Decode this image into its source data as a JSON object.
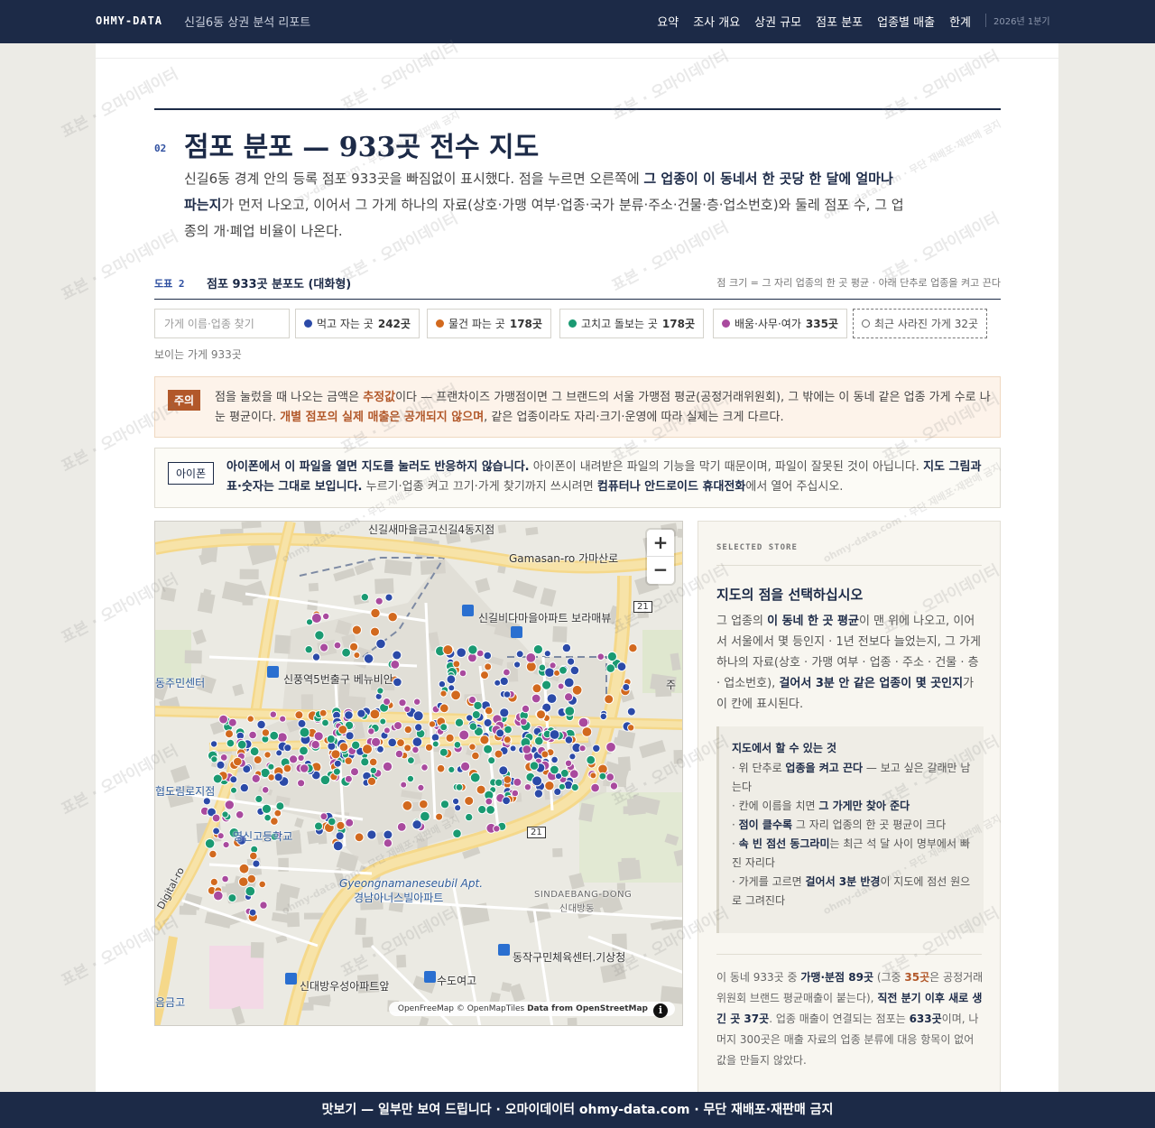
{
  "header": {
    "brand": "OHMY-DATA",
    "subtitle": "신길6동 상권 분석 리포트",
    "nav": [
      "요약",
      "조사 개요",
      "상권 규모",
      "점포 분포",
      "업종별 매출",
      "한계"
    ],
    "period": "2026년 1분기"
  },
  "section": {
    "number": "02",
    "title": "점포 분포 — 933곳 전수 지도",
    "lead_1": "신길6동 경계 안의 등록 점포 933곳을 빠짐없이 표시했다. 점을 누르면 오른쪽에 ",
    "lead_bold_1": "그 업종이 이 동네서 한 곳당 한 달에 얼마나 파는지",
    "lead_2": "가 먼저 나오고, 이어서 그 가게 하나의 자료(상호·가맹 여부·업종·국가 분류·주소·건물·층·업소번호)와 둘레 점포 수, 그 업종의 개·폐업 비율이 나온다."
  },
  "figure": {
    "label": "도표 2",
    "title": "점포 933곳 분포도 (대화형)",
    "note": "점 크기 = 그 자리 업종의 한 곳 평균 · 아래 단추로 업종을 켜고 끈다"
  },
  "controls": {
    "search_placeholder": "가게 이름·업종 찾기",
    "chips": [
      {
        "label": "먹고 자는 곳",
        "count": "242곳",
        "color": "#2b4aa8"
      },
      {
        "label": "물건 파는 곳",
        "count": "178곳",
        "color": "#d2691e"
      },
      {
        "label": "고치고 돌보는 곳",
        "count": "178곳",
        "color": "#1a9a72"
      },
      {
        "label": "배움·사무·여가",
        "count": "335곳",
        "color": "#a94a9e"
      }
    ],
    "closed_chip": "최근 사라진 가게 32곳",
    "visible_count": "보이는 가게 933곳"
  },
  "caution": {
    "tag": "주의",
    "t1": "점을 눌렀을 때 나오는 금액은 ",
    "h1": "추정값",
    "t2": "이다 — 프랜차이즈 가맹점이면 그 브랜드의 서울 가맹점 평균(공정거래위원회), 그 밖에는 이 동네 같은 업종 가게 수로 나눈 평균이다. ",
    "h2": "개별 점포의 실제 매출은 공개되지 않으며",
    "t3": ", 같은 업종이라도 자리·크기·운영에 따라 실제는 크게 다르다."
  },
  "iphone": {
    "tag": "아이폰",
    "b1": "아이폰에서 이 파일을 열면 지도를 눌러도 반응하지 않습니다.",
    "t1": " 아이폰이 내려받은 파일의 기능을 막기 때문이며, 파일이 잘못된 것이 아닙니다. ",
    "b2": "지도 그림과 표·숫자는 그대로 보입니다.",
    "t2": " 누르기·업종 켜고 끄기·가게 찾기까지 쓰시려면 ",
    "b3": "컴퓨터나 안드로이드 휴대전화",
    "t3": "에서 열어 주십시오."
  },
  "map": {
    "zoom_in": "+",
    "zoom_out": "−",
    "attribution_1": "OpenFreeMap © OpenMapTiles ",
    "attribution_2": "Data from OpenStreetMap",
    "info": "i",
    "labels": {
      "l1": "신길새마을금고신길4동지점",
      "l2": "Gamasan-ro 가마산로",
      "l3": "신길비다마을아파트 보라매뷰",
      "l4": "동주민센터",
      "l5": "신풍역5번출구 베뉴비안",
      "l6": "주",
      "l7": "협도림로지점",
      "l8": "영신고등학교",
      "l9": "Gyeongnamaneseubil Apt.",
      "l10": "경남아너스빌아파트",
      "l11": "SINDAEBANG-DONG",
      "l12": "신대방동",
      "l13": "동작구민체육센터.기상청",
      "l14": "신대방우성아파트앞",
      "l15": "수도여고",
      "l16": "음금고",
      "l17": "Digital-ro",
      "r21a": "21",
      "r21b": "21"
    }
  },
  "side": {
    "kicker": "SELECTED STORE",
    "title": "지도의 점을 선택하십시오",
    "b_t1": "그 업종의 ",
    "b_b1": "이 동네 한 곳 평균",
    "b_t2": "이 맨 위에 나오고, 이어서 서울에서 몇 등인지 · 1년 전보다 늘었는지, 그 가게 하나의 자료(상호 · 가맹 여부 · 업종 · 주소 · 건물 · 층 · 업소번호), ",
    "b_b2": "걸어서 3분 안 같은 업종이 몇 곳인지",
    "b_t3": "가 이 칸에 표시된다.",
    "howto_title": "지도에서 할 수 있는 것",
    "howto": [
      {
        "pre": "· 위 단추로 ",
        "bold": "업종을 켜고 끈다",
        "post": " — 보고 싶은 갈래만 남는다"
      },
      {
        "pre": "· 칸에 이름을 치면 ",
        "bold": "그 가게만 찾아 준다",
        "post": ""
      },
      {
        "pre": "· ",
        "bold": "점이 클수록",
        "post": " 그 자리 업종의 한 곳 평균이 크다"
      },
      {
        "pre": "· ",
        "bold": "속 빈 점선 동그라미",
        "post": "는 최근 석 달 사이 명부에서 빠진 자리다"
      },
      {
        "pre": "· 가게를 고르면 ",
        "bold": "걸어서 3분 반경",
        "post": "이 지도에 점선 원으로 그려진다"
      }
    ],
    "f_t1": "이 동네 933곳 중 ",
    "f_b1": "가맹·분점 89곳",
    "f_t2": " (그중 ",
    "f_h1": "35곳",
    "f_t3": "은 공정거래위원회 브랜드 평균매출이 붙는다), ",
    "f_b2": "직전 분기 이후 새로 생긴 곳 37곳",
    "f_t4": ". 업종 매출이 연결되는 점포는 ",
    "f_b3": "633곳",
    "f_t5": "이며, 나머지 300곳은 매출 자료의 업종 분류에 대응 항목이 없어 값을 만들지 않았다."
  },
  "watermark": "표본 · 오마이데이터",
  "watermark2": "ohmy-data.com · 무단 재배포·재판매 금지",
  "footer": "맛보기 — 일부만 보여 드립니다 · 오마이데이터 ohmy-data.com · 무단 재배포·재판매 금지"
}
